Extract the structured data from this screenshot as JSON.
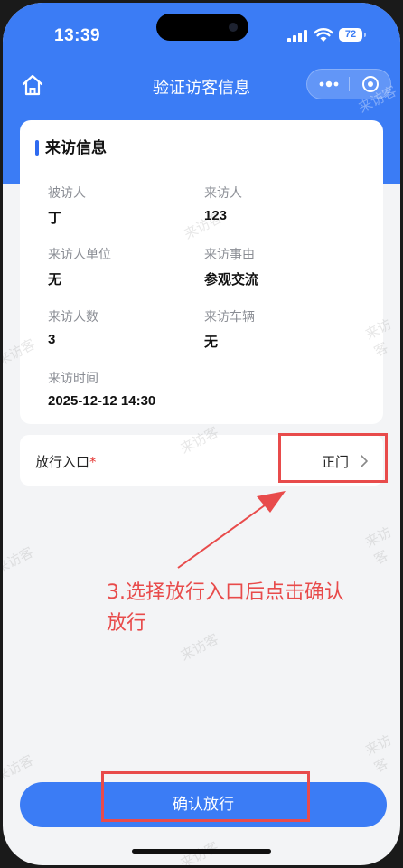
{
  "status_bar": {
    "time": "13:39",
    "battery": "72"
  },
  "nav": {
    "title": "验证访客信息"
  },
  "visitor_card": {
    "title": "来访信息",
    "fields": [
      {
        "label": "被访人",
        "value": "丁"
      },
      {
        "label": "来访人",
        "value": "123"
      },
      {
        "label": "来访人单位",
        "value": "无"
      },
      {
        "label": "来访事由",
        "value": "参观交流"
      },
      {
        "label": "来访人数",
        "value": "3"
      },
      {
        "label": "来访车辆",
        "value": "无"
      },
      {
        "label": "来访时间",
        "value": "2025-12-12 14:30"
      }
    ]
  },
  "entry": {
    "label": "放行入口",
    "required_mark": "*",
    "value": "正门"
  },
  "annotation": {
    "text": "3.选择放行入口后点击确认放行"
  },
  "confirm_button": {
    "label": "确认放行"
  },
  "watermark": {
    "text": "来访客"
  },
  "colors": {
    "primary": "#3b7cf5",
    "annotation_red": "#e84b4b",
    "required_red": "#e53935"
  }
}
